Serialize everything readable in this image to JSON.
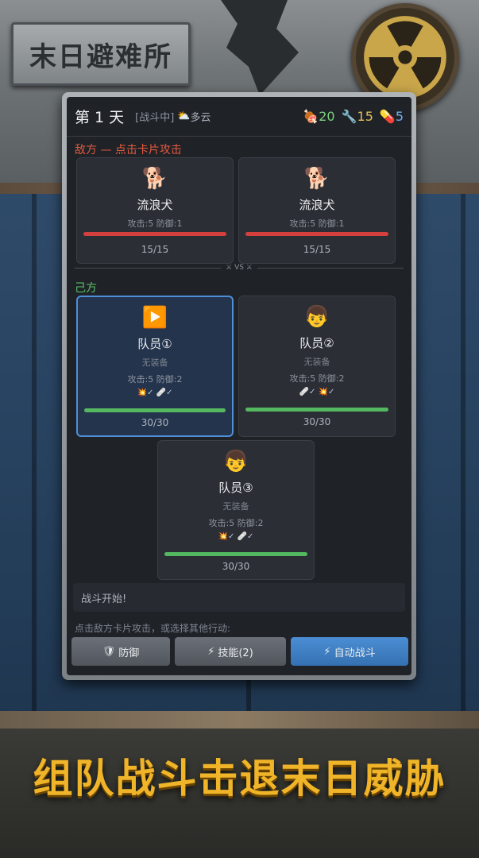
{
  "game": {
    "logo_text": "末日避难所",
    "slogan": "组队战斗击退末日威胁"
  },
  "hud": {
    "day": "第 1 天",
    "status": "[战斗中]",
    "weather_icon": "⛅",
    "weather": "多云",
    "resources": [
      {
        "icon": "🍖",
        "value": "20",
        "color": "#7bd27e"
      },
      {
        "icon": "🔧",
        "value": "15",
        "color": "#e1c15a"
      },
      {
        "icon": "💊",
        "value": "5",
        "color": "#6eb0f0"
      }
    ]
  },
  "enemy_section": {
    "label": "敌方 — 点击卡片攻击",
    "cards": [
      {
        "icon": "🐕",
        "name": "流浪犬",
        "stats": "攻击:5  防御:1",
        "hp": "15/15",
        "hp_fraction": 1.0
      },
      {
        "icon": "🐕",
        "name": "流浪犬",
        "stats": "攻击:5  防御:1",
        "hp": "15/15",
        "hp_fraction": 1.0
      }
    ]
  },
  "vs_label": "⚔ VS ⚔",
  "ally_section": {
    "label": "己方",
    "cards": [
      {
        "icon": "▶️",
        "name": "队员①",
        "equip": "无装备",
        "stats": "攻击:5  防御:2",
        "buffs": "💥✓ 🩹✓",
        "hp": "30/30",
        "hp_fraction": 1.0,
        "selected": true
      },
      {
        "icon": "👦",
        "name": "队员②",
        "equip": "无装备",
        "stats": "攻击:5  防御:2",
        "buffs": "🩹✓ 💥✓",
        "hp": "30/30",
        "hp_fraction": 1.0,
        "selected": false
      },
      {
        "icon": "👦",
        "name": "队员③",
        "equip": "无装备",
        "stats": "攻击:5  防御:2",
        "buffs": "💥✓ 🩹✓",
        "hp": "30/30",
        "hp_fraction": 1.0,
        "selected": false
      }
    ]
  },
  "battle_log": "战斗开始!",
  "hint": "点击敌方卡片攻击，或选择其他行动:",
  "actions": {
    "defend": {
      "icon": "🛡",
      "label": "防御"
    },
    "skill": {
      "icon": "⚡",
      "label": "技能(2)"
    },
    "auto": {
      "icon": "⚡",
      "label": "自动战斗"
    }
  },
  "colors": {
    "accent": "#4f8ed8",
    "enemy": "#e2593f",
    "ally": "#5bc46a",
    "slogan": "#f0b429"
  }
}
